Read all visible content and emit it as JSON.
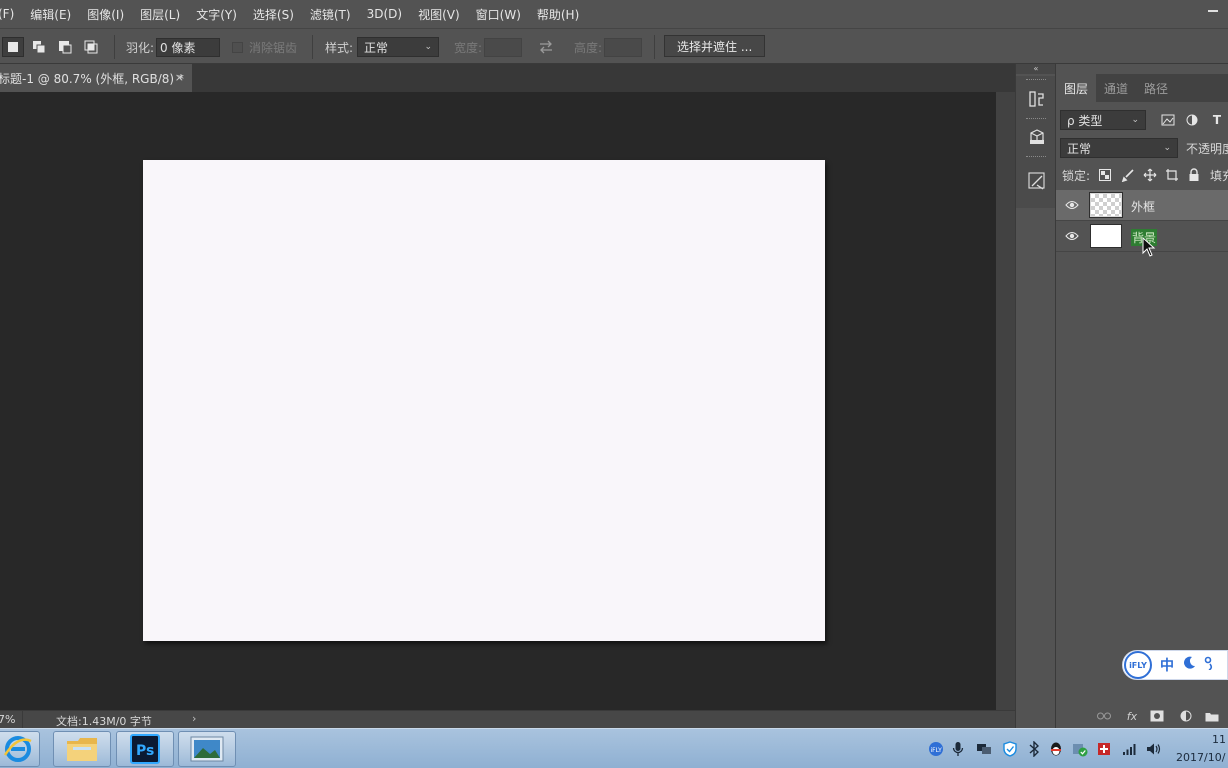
{
  "menubar": {
    "items": [
      "(F)",
      "编辑(E)",
      "图像(I)",
      "图层(L)",
      "文字(Y)",
      "选择(S)",
      "滤镜(T)",
      "3D(D)",
      "视图(V)",
      "窗口(W)",
      "帮助(H)"
    ]
  },
  "options": {
    "feather_label": "羽化:",
    "feather_value": "0 像素",
    "antialias_label": "消除锯齿",
    "style_label": "样式:",
    "style_value": "正常",
    "width_label": "宽度:",
    "height_label": "高度:",
    "refine_button": "选择并遮住 ..."
  },
  "document": {
    "tab_title": "标题-1 @ 80.7% (外框, RGB/8) *",
    "close_symbol": "×",
    "canvas_color": "#f9f6fa"
  },
  "status": {
    "zoom": "7%",
    "doc_info": "文档:1.43M/0 字节",
    "arrow": "›"
  },
  "layers_panel": {
    "tabs": [
      "图层",
      "通道",
      "路径"
    ],
    "filter_label": "ρ 类型",
    "blend_mode": "正常",
    "opacity_label": "不透明度",
    "lock_label": "锁定:",
    "fill_label": "填充",
    "layers": [
      {
        "name": "外框",
        "thumb": "transparent",
        "selected": true
      },
      {
        "name": "背景",
        "thumb": "white",
        "selected": false
      }
    ]
  },
  "ime": {
    "logo": "iFLY",
    "lang": "中"
  },
  "taskbar": {
    "time": "11",
    "date": "2017/10/"
  }
}
